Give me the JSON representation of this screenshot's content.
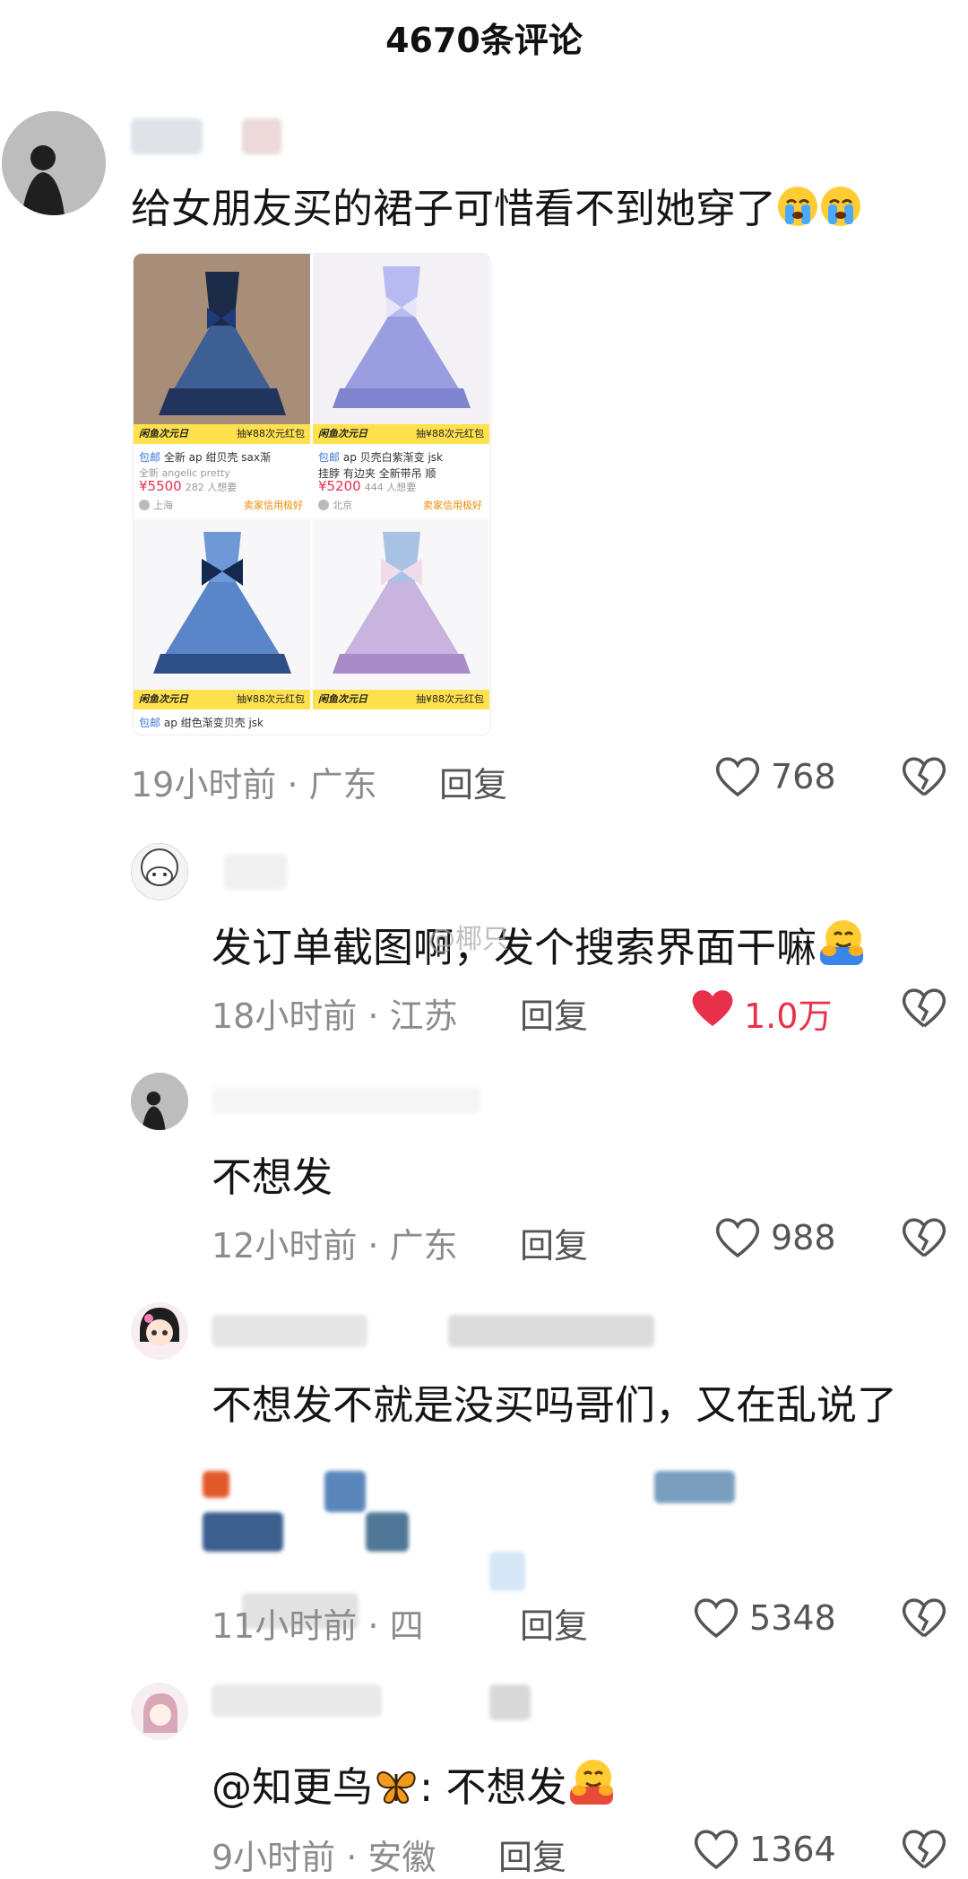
{
  "header": {
    "title": "4670条评论"
  },
  "comments": [
    {
      "text": "给女朋友买的裙子可惜看不到她穿了",
      "emoji": "crying-face-icon",
      "time": "19小时前 · 广东",
      "reply": "回复",
      "likes": "768",
      "liked": false
    },
    {
      "text": "发订单截图啊，发个搜索界面干嘛",
      "emoji": "hugging-face-icon",
      "time": "18小时前 · 江苏",
      "reply": "回复",
      "likes": "1.0万",
      "liked": true
    },
    {
      "text": "不想发",
      "time": "12小时前 · 广东",
      "reply": "回复",
      "likes": "988",
      "liked": false
    },
    {
      "text": "不想发不就是没买吗哥们，又在乱说了",
      "time": "11小时前 · 四",
      "reply": "回复",
      "likes": "5348",
      "liked": false
    },
    {
      "text_prefix": "@知更鸟",
      "text_suffix": ": 不想发",
      "emoji": "butterfly-icon",
      "emoji2": "hugging-face-icon",
      "time": "9小时前 · 安徽",
      "reply": "回复",
      "likes": "1364",
      "liked": false
    }
  ],
  "watermark": "@椰只",
  "product_image": {
    "cards": [
      {
        "banner_left": "闲鱼次元日",
        "banner_right": "抽¥88次元红包",
        "tag": "包邮",
        "line1": "全新 ap 绀贝壳 sax渐",
        "line2": "全新  angelic pretty",
        "price": "¥5500",
        "want": "282 人想要",
        "location": "上海",
        "credit": "卖家信用极好",
        "dress_color": "#3d5f94"
      },
      {
        "banner_left": "闲鱼次元日",
        "banner_right": "抽¥88次元红包",
        "tag": "包邮",
        "line1": "ap 贝壳白紫渐变 jsk",
        "line2": "挂脖 有边夹 全新带吊 顺",
        "price": "¥5200",
        "want": "444 人想要",
        "location": "北京",
        "credit": "卖家信用极好",
        "dress_color": "#9a9ee0"
      },
      {
        "banner_left": "闲鱼次元日",
        "banner_right": "抽¥88次元红包",
        "tag": "包邮",
        "line1": "ap 绀色渐变贝壳 jsk",
        "dress_color": "#5a86c8"
      },
      {
        "banner_left": "闲鱼次元日",
        "banner_right": "抽¥88次元红包",
        "dress_color": "#c9b4df"
      }
    ]
  }
}
